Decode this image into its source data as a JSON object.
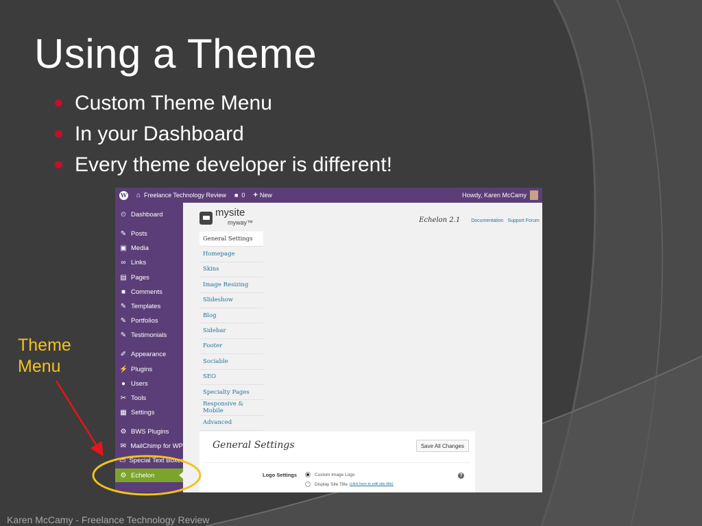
{
  "slide": {
    "title": "Using a Theme",
    "bullets": [
      "Custom Theme Menu",
      "In your Dashboard",
      "Every theme developer is different!"
    ],
    "annotation_label": [
      "Theme",
      "Menu"
    ],
    "footer": "Karen McCamy - Freelance Technology Review",
    "colors": {
      "background": "#3c3c3c",
      "bullet": "#c0102a",
      "annotation": "#f3c21d",
      "arrow": "#e8141b"
    }
  },
  "admin_bar": {
    "site_name": "Freelance Technology Review",
    "comments_count": "0",
    "new_label": "New",
    "greeting": "Howdy, Karen McCamy",
    "icons": [
      "wordpress-icon",
      "home-icon",
      "comment-icon",
      "plus-icon"
    ]
  },
  "sidebar": {
    "items": [
      {
        "label": "Dashboard",
        "icon": "dashboard-icon",
        "glyph": "⏲"
      },
      {
        "label": "Posts",
        "icon": "pin-icon",
        "glyph": "✎"
      },
      {
        "label": "Media",
        "icon": "media-icon",
        "glyph": "▣"
      },
      {
        "label": "Links",
        "icon": "link-icon",
        "glyph": "∞"
      },
      {
        "label": "Pages",
        "icon": "pages-icon",
        "glyph": "▤"
      },
      {
        "label": "Comments",
        "icon": "comment-icon",
        "glyph": "■"
      },
      {
        "label": "Templates",
        "icon": "pin-icon",
        "glyph": "✎"
      },
      {
        "label": "Portfolios",
        "icon": "pin-icon",
        "glyph": "✎"
      },
      {
        "label": "Testimonials",
        "icon": "pin-icon",
        "glyph": "✎"
      },
      {
        "label": "Appearance",
        "icon": "brush-icon",
        "glyph": "✐"
      },
      {
        "label": "Plugins",
        "icon": "plugin-icon",
        "glyph": "⚡"
      },
      {
        "label": "Users",
        "icon": "user-icon",
        "glyph": "●"
      },
      {
        "label": "Tools",
        "icon": "wrench-icon",
        "glyph": "✂"
      },
      {
        "label": "Settings",
        "icon": "settings-icon",
        "glyph": "▦"
      },
      {
        "label": "BWS Plugins",
        "icon": "gear-icon",
        "glyph": "⚙"
      },
      {
        "label": "MailChimp for WP",
        "icon": "mail-icon",
        "glyph": "✉"
      },
      {
        "label": "Special Text Boxes",
        "icon": "textbox-icon",
        "glyph": "▭"
      },
      {
        "label": "Echelon",
        "icon": "gear-icon",
        "glyph": "⚙"
      }
    ],
    "active": "Echelon"
  },
  "theme_page": {
    "brand_name": "mysite",
    "brand_tag": "myway",
    "theme_version": "Echelon 2.1",
    "links": [
      "Documentation",
      "Support Forum"
    ],
    "tabs": [
      "General Settings",
      "Homepage",
      "Skins",
      "Image Resizing",
      "Slideshow",
      "Blog",
      "Sidebar",
      "Footer",
      "Sociable",
      "SEO",
      "Specialty Pages",
      "Responsive & Mobile",
      "Advanced"
    ],
    "active_tab": "General Settings",
    "panel_title": "General Settings",
    "save_button": "Save All Changes",
    "logo_settings_label": "Logo Settings",
    "logo_options": [
      {
        "label": "Custom Image Logo",
        "selected": true,
        "link": ""
      },
      {
        "label": "Display Site Title",
        "selected": false,
        "link": "(click here to edit site title)"
      }
    ],
    "help_glyph": "?"
  }
}
